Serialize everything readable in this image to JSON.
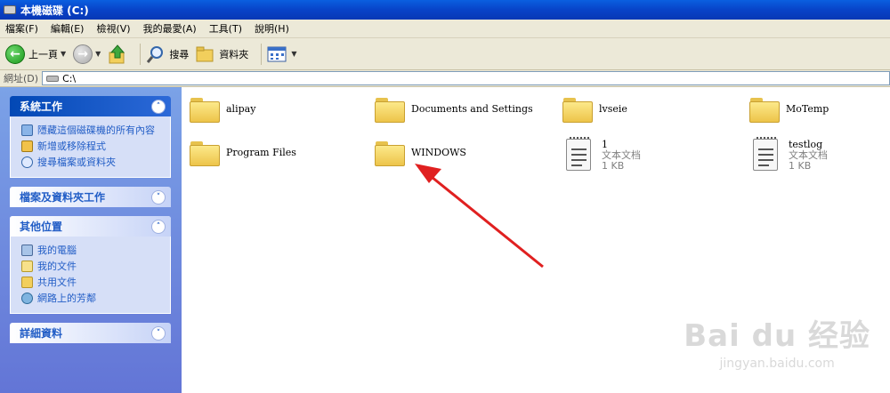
{
  "window": {
    "title": "本機磁碟 (C:)"
  },
  "menu": [
    "檔案(F)",
    "編輯(E)",
    "檢視(V)",
    "我的最愛(A)",
    "工具(T)",
    "說明(H)"
  ],
  "toolbar": {
    "back_label": "上一頁",
    "search_label": "搜尋",
    "folders_label": "資料夾"
  },
  "address": {
    "label": "網址(D)",
    "value": "C:\\"
  },
  "sidebar": {
    "system_tasks": {
      "title": "系統工作",
      "items": [
        "隱藏這個磁碟機的所有內容",
        "新增或移除程式",
        "搜尋檔案或資料夾"
      ]
    },
    "file_folder_tasks": {
      "title": "檔案及資料夾工作"
    },
    "other_places": {
      "title": "其他位置",
      "items": [
        "我的電腦",
        "我的文件",
        "共用文件",
        "網路上的芳鄰"
      ]
    },
    "details": {
      "title": "詳細資料"
    }
  },
  "files": [
    {
      "name": "alipay",
      "kind": "folder"
    },
    {
      "name": "Documents and Settings",
      "kind": "folder"
    },
    {
      "name": "lvseie",
      "kind": "folder"
    },
    {
      "name": "MoTemp",
      "kind": "folder"
    },
    {
      "name": "Program Files",
      "kind": "folder"
    },
    {
      "name": "WINDOWS",
      "kind": "folder"
    },
    {
      "name": "1",
      "kind": "file",
      "type": "文本文档",
      "size": "1 KB"
    },
    {
      "name": "testlog",
      "kind": "file",
      "type": "文本文档",
      "size": "1 KB"
    }
  ],
  "colors": {
    "title_bar": "#0a5fe0",
    "sidebar_bg": "#6375d6",
    "arrow": "#e02020"
  },
  "watermark": {
    "main": "Bai du 经验",
    "sub": "jingyan.baidu.com"
  }
}
